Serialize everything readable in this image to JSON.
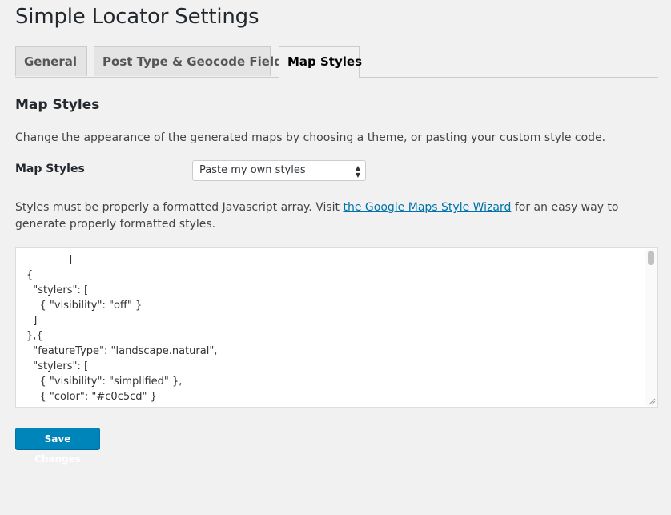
{
  "page": {
    "title": "Simple Locator Settings"
  },
  "tabs": [
    {
      "label": "General",
      "active": false
    },
    {
      "label": "Post Type & Geocode Fields",
      "active": false
    },
    {
      "label": "Map Styles",
      "active": true
    }
  ],
  "section": {
    "heading": "Map Styles",
    "description": "Change the appearance of the generated maps by choosing a theme, or pasting your custom style code."
  },
  "map_styles_field": {
    "label": "Map Styles",
    "selected": "Paste my own styles",
    "arrow_up_icon": "triangle-up",
    "arrow_down_icon": "triangle-down"
  },
  "help": {
    "before": "Styles must be properly a formatted Javascript array. Visit ",
    "link_text": "the Google Maps Style Wizard",
    "after": " for an easy way to generate properly formatted styles."
  },
  "styles_code": "             [\n{\n  \"stylers\": [\n    { \"visibility\": \"off\" }\n  ]\n},{\n  \"featureType\": \"landscape.natural\",\n  \"stylers\": [\n    { \"visibility\": \"simplified\" },\n    { \"color\": \"#c0c5cd\" }\n  ]",
  "actions": {
    "save_label": "Save Changes"
  },
  "colors": {
    "background": "#f1f1f1",
    "primary_button": "#0085ba",
    "link": "#0073aa"
  }
}
